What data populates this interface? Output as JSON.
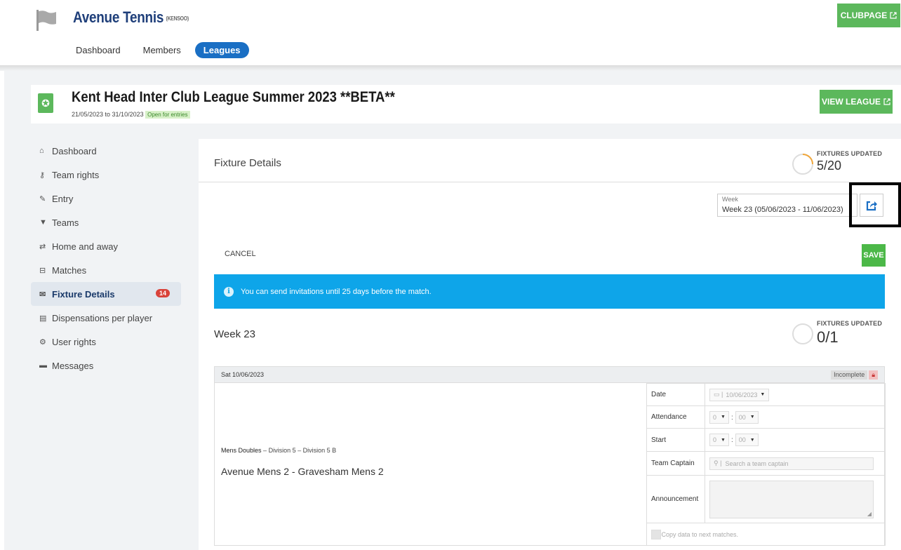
{
  "header": {
    "club_name": "Avenue Tennis",
    "club_code": "(KENSOO)",
    "clubpage_label": "CLUBPAGE",
    "nav": [
      "Dashboard",
      "Members",
      "Leagues"
    ],
    "active_nav": "Leagues"
  },
  "league": {
    "title": "Kent Head Inter Club League Summer 2023 **BETA**",
    "dates": "21/05/2023 to 31/10/2023",
    "status": "Open for entries",
    "view_label": "VIEW LEAGUE"
  },
  "sidebar": {
    "items": [
      {
        "label": "Dashboard",
        "icon": "home-icon"
      },
      {
        "label": "Team rights",
        "icon": "key-icon"
      },
      {
        "label": "Entry",
        "icon": "pencil-icon"
      },
      {
        "label": "Teams",
        "icon": "shirt-icon"
      },
      {
        "label": "Home and away",
        "icon": "swap-icon"
      },
      {
        "label": "Matches",
        "icon": "bracket-icon"
      },
      {
        "label": "Fixture Details",
        "icon": "envelope-icon",
        "badge": "14",
        "active": true
      },
      {
        "label": "Dispensations per player",
        "icon": "id-card-icon"
      },
      {
        "label": "User rights",
        "icon": "gear-icon"
      },
      {
        "label": "Messages",
        "icon": "message-icon"
      }
    ]
  },
  "main": {
    "title": "Fixture Details",
    "fixtures_updated_label": "FIXTURES UPDATED",
    "fixtures_updated_value": "5/20",
    "fixtures_updated_fraction": 0.25,
    "week_label": "Week",
    "week_value": "Week 23 (05/06/2023 - 11/06/2023)",
    "cancel_label": "CANCEL",
    "save_label": "SAVE",
    "info_text": "You can send invitations until 25 days before the match.",
    "week_heading": "Week 23",
    "week_updated_label": "FIXTURES UPDATED",
    "week_updated_value": "0/1",
    "week_updated_fraction": 0
  },
  "fixture": {
    "date": "Sat 10/06/2023",
    "status": "Incomplete",
    "category": "Mens Doubles",
    "division": "Division 5",
    "sub_division": "Division 5 B",
    "separator": "–",
    "match": "Avenue Mens 2 - Gravesham Mens 2",
    "form": {
      "date_label": "Date",
      "date_value": "10/06/2023",
      "attendance_label": "Attendance",
      "start_label": "Start",
      "hour_value": "0",
      "minute_value": "00",
      "time_sep": ":",
      "captain_label": "Team Captain",
      "captain_placeholder": "Search a team captain",
      "announcement_label": "Announcement",
      "copy_label": "Copy data to next matches."
    }
  },
  "colors": {
    "accent_green": "#5cb85c",
    "nav_blue": "#1a6fc4",
    "info_blue": "#0ea5e9",
    "badge_red": "#d9433a",
    "ring_orange": "#f0a63a"
  }
}
